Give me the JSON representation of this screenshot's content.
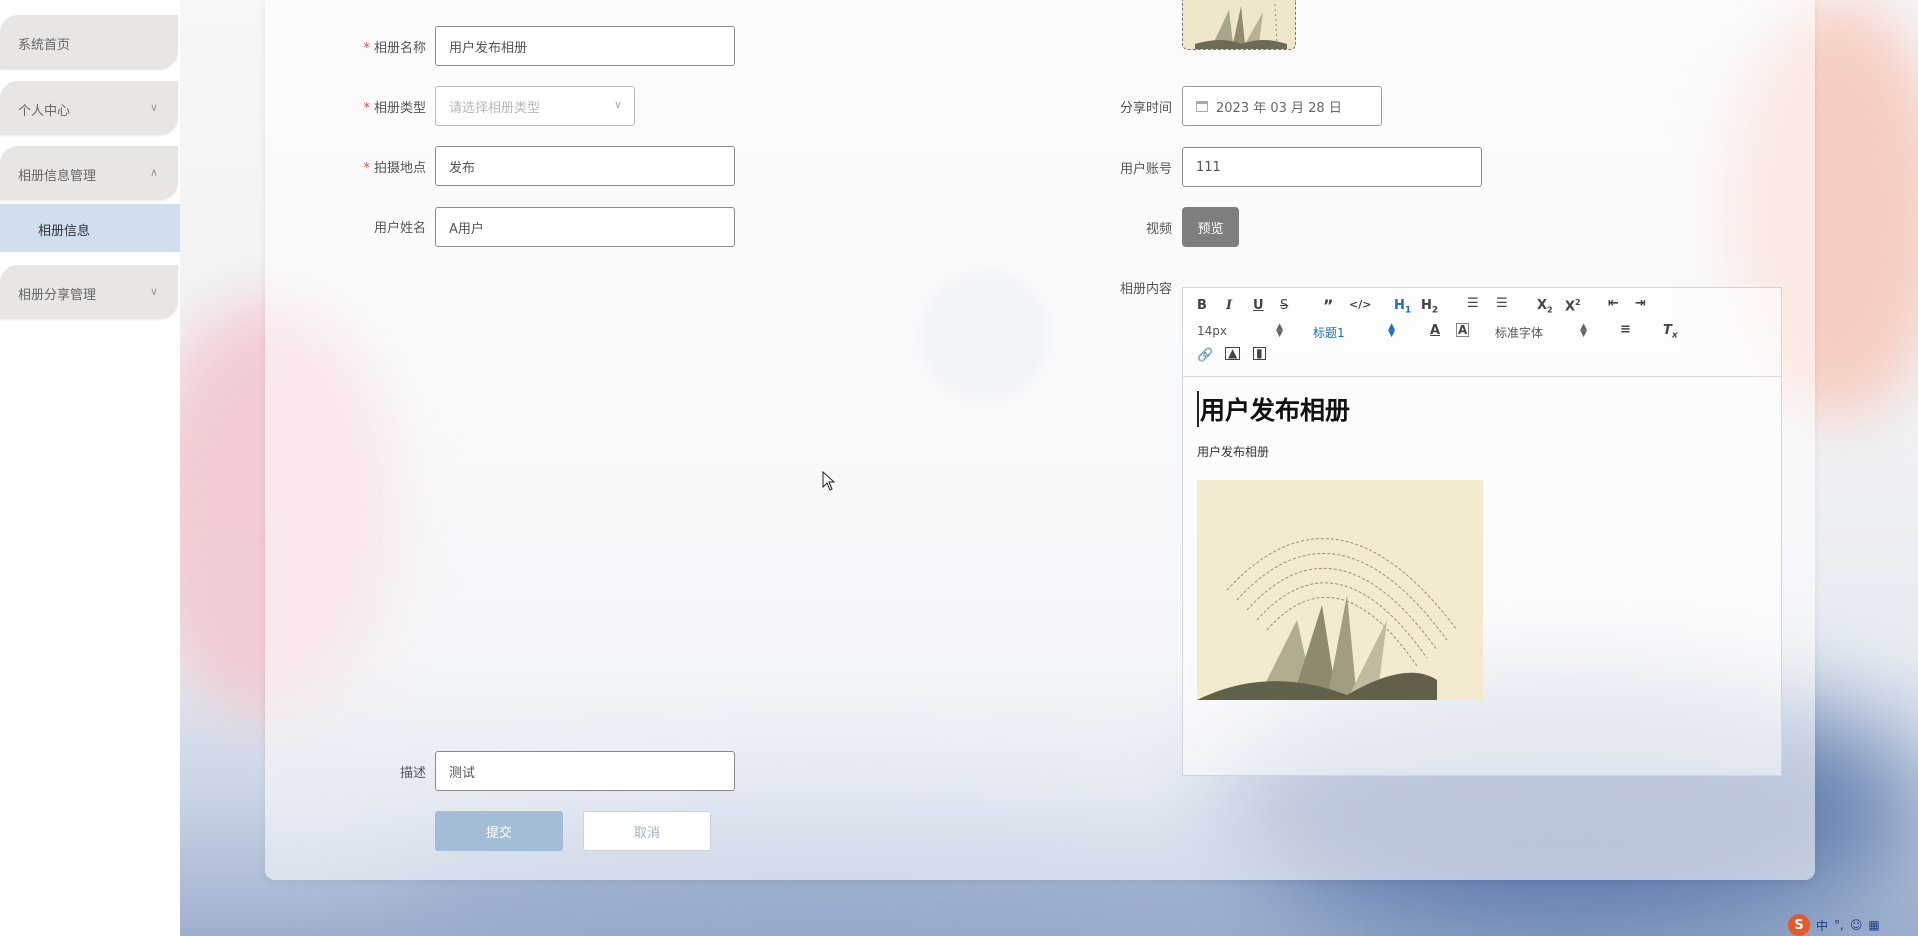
{
  "sidebar": {
    "items": [
      {
        "label": "系统首页"
      },
      {
        "label": "个人中心"
      },
      {
        "label": "相册信息管理"
      },
      {
        "label": "相册分享管理"
      }
    ],
    "sub_items": [
      {
        "label": "相册信息"
      }
    ]
  },
  "form": {
    "album_name": {
      "label": "相册名称",
      "value": "用户发布相册"
    },
    "album_type": {
      "label": "相册类型",
      "placeholder": "请选择相册类型"
    },
    "location": {
      "label": "拍摄地点",
      "value": "发布"
    },
    "user_name": {
      "label": "用户姓名",
      "value": "A用户"
    },
    "description": {
      "label": "描述",
      "value": "测试"
    },
    "share_time": {
      "label": "分享时间",
      "value": "2023 年 03 月 28 日"
    },
    "user_account": {
      "label": "用户账号",
      "value": "111"
    },
    "video": {
      "label": "视频",
      "preview_label": "预览"
    },
    "content": {
      "label": "相册内容"
    },
    "submit_label": "提交",
    "cancel_label": "取消"
  },
  "editor": {
    "font_size": "14px",
    "heading": "标题1",
    "font_family": "标准字体",
    "heading_text": "用户发布相册",
    "paragraph_text": "用户发布相册",
    "toolbar_icons": [
      "bold-icon",
      "italic-icon",
      "underline-icon",
      "strike-icon",
      "quote-icon",
      "code-icon",
      "h1-icon",
      "h2-icon",
      "ordered-list-icon",
      "bullet-list-icon",
      "subscript-icon",
      "superscript-icon",
      "outdent-icon",
      "indent-icon",
      "text-color-icon",
      "background-color-icon",
      "align-icon",
      "clear-format-icon",
      "link-icon",
      "image-icon",
      "video-icon"
    ]
  },
  "tray": {
    "ime": "中"
  }
}
